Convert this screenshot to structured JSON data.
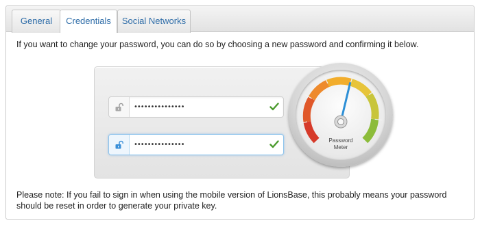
{
  "tabs": [
    {
      "label": "General"
    },
    {
      "label": "Credentials"
    },
    {
      "label": "Social Networks"
    }
  ],
  "intro_text": "If you want to change your password, you can do so by choosing a new password and confirming it below.",
  "fields": [
    {
      "value": "•••••••••••••••",
      "state": "valid",
      "lock": "unlocked"
    },
    {
      "value": "•••••••••••••••",
      "state": "valid",
      "lock": "unlocked"
    }
  ],
  "meter": {
    "label_line1": "Password",
    "label_line2": "Meter",
    "strength_level": 0.55
  },
  "note_text": "Please note: If you fail to sign in when using the mobile version of LionsBase, this probably means your password should be reset in order to generate your private key.",
  "colors": {
    "tab_text": "#2f6da8",
    "check": "#4a9a2c",
    "needle": "#2d8fd6"
  }
}
